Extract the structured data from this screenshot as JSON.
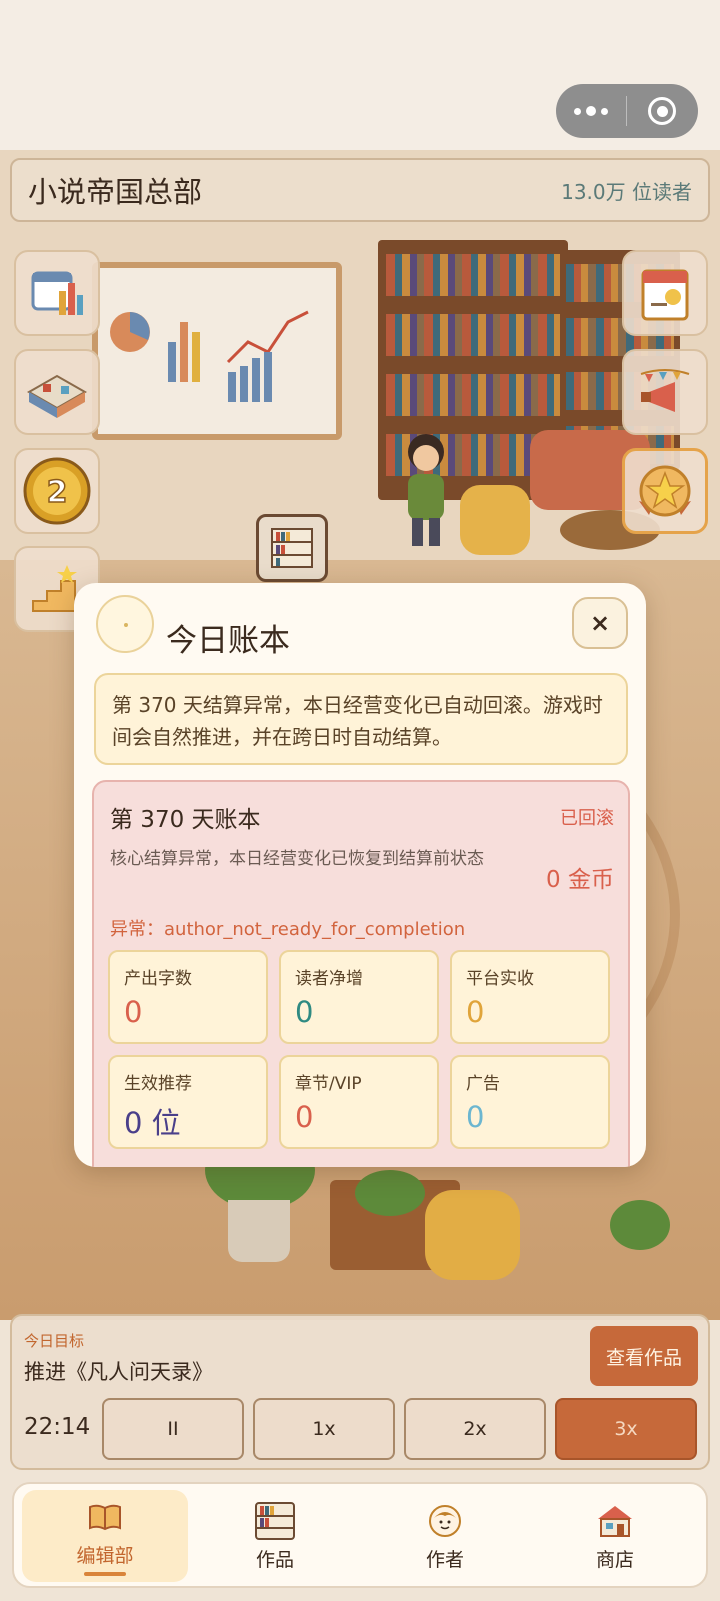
{
  "header": {
    "title": "小说帝国总部",
    "readers": "13.0万 位读者"
  },
  "side_buttons_left": [
    {
      "name": "calendar-chart-icon"
    },
    {
      "name": "building-icon"
    },
    {
      "name": "coin-2-icon",
      "text": "2"
    },
    {
      "name": "stairs-star-icon"
    }
  ],
  "side_buttons_right": [
    {
      "name": "daily-calendar-icon"
    },
    {
      "name": "megaphone-icon"
    },
    {
      "name": "star-badge-icon"
    }
  ],
  "modal": {
    "title": "今日账本",
    "close_label": "×",
    "notice": "第 370 天结算异常，本日经营变化已自动回滚。游戏时间会自然推进，并在跨日时自动结算。",
    "ledger": {
      "title": "第 370 天账本",
      "status": "已回滚",
      "description": "核心结算异常，本日经营变化已恢复到结算前状态",
      "coins": "0 金币",
      "error": "异常：author_not_ready_for_completion",
      "stats": [
        {
          "label": "产出字数",
          "value": "0",
          "color": "#d9604c"
        },
        {
          "label": "读者净增",
          "value": "0",
          "color": "#2f8a82"
        },
        {
          "label": "平台实收",
          "value": "0",
          "color": "#e0a43a"
        },
        {
          "label": "生效推荐",
          "value": "0 位",
          "color": "#4a3f8a"
        },
        {
          "label": "章节/VIP",
          "value": "0",
          "color": "#d9604c"
        },
        {
          "label": "广告",
          "value": "0",
          "color": "#6cb6d0"
        }
      ]
    }
  },
  "control": {
    "goal_label": "今日目标",
    "goal_title": "推进《凡人问天录》",
    "view_button": "查看作品",
    "clock": "22:14",
    "speeds": [
      "II",
      "1x",
      "2x",
      "3x"
    ],
    "active_speed": "3x"
  },
  "tabs": [
    {
      "label": "编辑部",
      "icon": "book-icon",
      "active": true
    },
    {
      "label": "作品",
      "icon": "bookshelf-icon",
      "active": false
    },
    {
      "label": "作者",
      "icon": "author-avatar-icon",
      "active": false
    },
    {
      "label": "商店",
      "icon": "shop-icon",
      "active": false
    }
  ],
  "colors": {
    "accent": "#c6693a",
    "danger": "#d9604c",
    "panel": "#fffaf2"
  }
}
